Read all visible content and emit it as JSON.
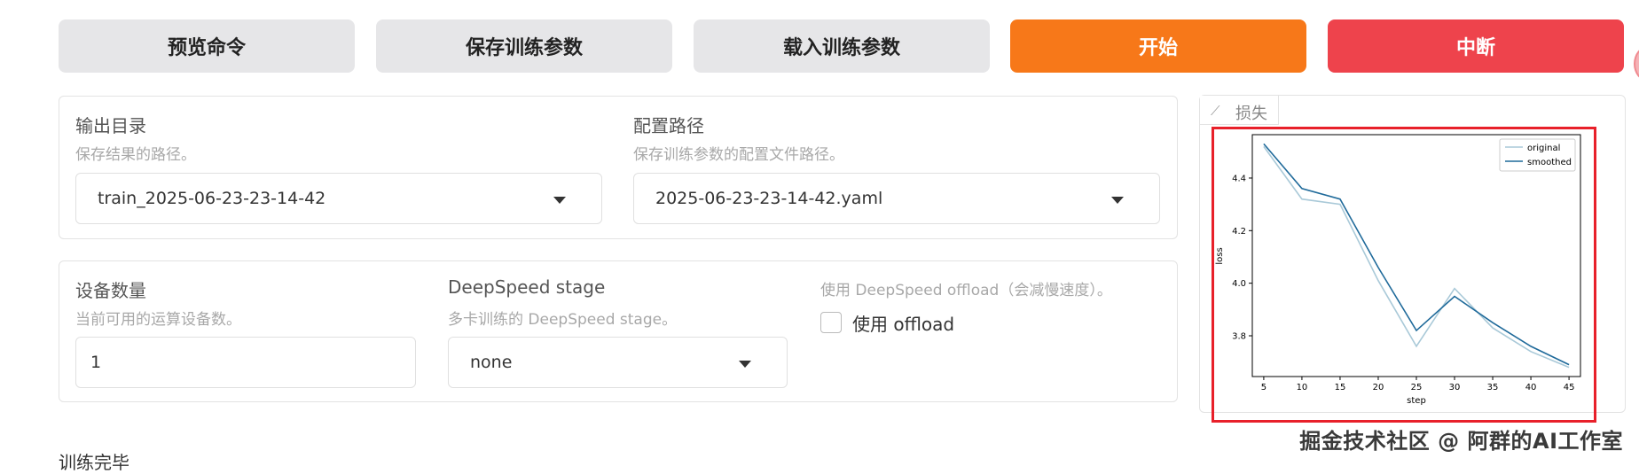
{
  "toolbar": {
    "preview_label": "预览命令",
    "save_label": "保存训练参数",
    "load_label": "载入训练参数",
    "start_label": "开始",
    "abort_label": "中断"
  },
  "output_section": {
    "output_dir": {
      "label": "输出目录",
      "hint": "保存结果的路径。",
      "value": "train_2025-06-23-23-14-42"
    },
    "config_path": {
      "label": "配置路径",
      "hint": "保存训练参数的配置文件路径。",
      "value": "2025-06-23-23-14-42.yaml"
    }
  },
  "device_section": {
    "device_count": {
      "label": "设备数量",
      "hint": "当前可用的运算设备数。",
      "value": "1"
    },
    "ds_stage": {
      "label": "DeepSpeed stage",
      "hint": "多卡训练的 DeepSpeed stage。",
      "value": "none"
    },
    "ds_offload": {
      "hint": "使用 DeepSpeed offload（会减慢速度）。",
      "checkbox_label": "使用 offload",
      "checked": false
    }
  },
  "loss_panel": {
    "tab_label": "损失",
    "tab_icon": "chart-icon",
    "highlight_color": "#e8202a"
  },
  "chart_data": {
    "type": "line",
    "xlabel": "step",
    "ylabel": "loss",
    "x": [
      5,
      10,
      15,
      20,
      25,
      30,
      35,
      40,
      45
    ],
    "xticks": [
      "5",
      "10",
      "15",
      "20",
      "25",
      "30",
      "35",
      "40",
      "45"
    ],
    "yticks": [
      "3.8",
      "4.0",
      "4.2",
      "4.4"
    ],
    "xlim": [
      3.5,
      46.5
    ],
    "ylim": [
      3.645,
      4.565
    ],
    "legend_position": "top-right",
    "series": [
      {
        "name": "original",
        "color": "#a9c9d8",
        "values": [
          4.52,
          4.32,
          4.3,
          4.01,
          3.76,
          3.98,
          3.83,
          3.74,
          3.68
        ]
      },
      {
        "name": "smoothed",
        "color": "#1f6a9a",
        "values": [
          4.53,
          4.36,
          4.32,
          4.06,
          3.82,
          3.95,
          3.85,
          3.76,
          3.69
        ]
      }
    ]
  },
  "status_text": "训练完毕",
  "watermark": "掘金技术社区 @ 阿群的AI工作室"
}
